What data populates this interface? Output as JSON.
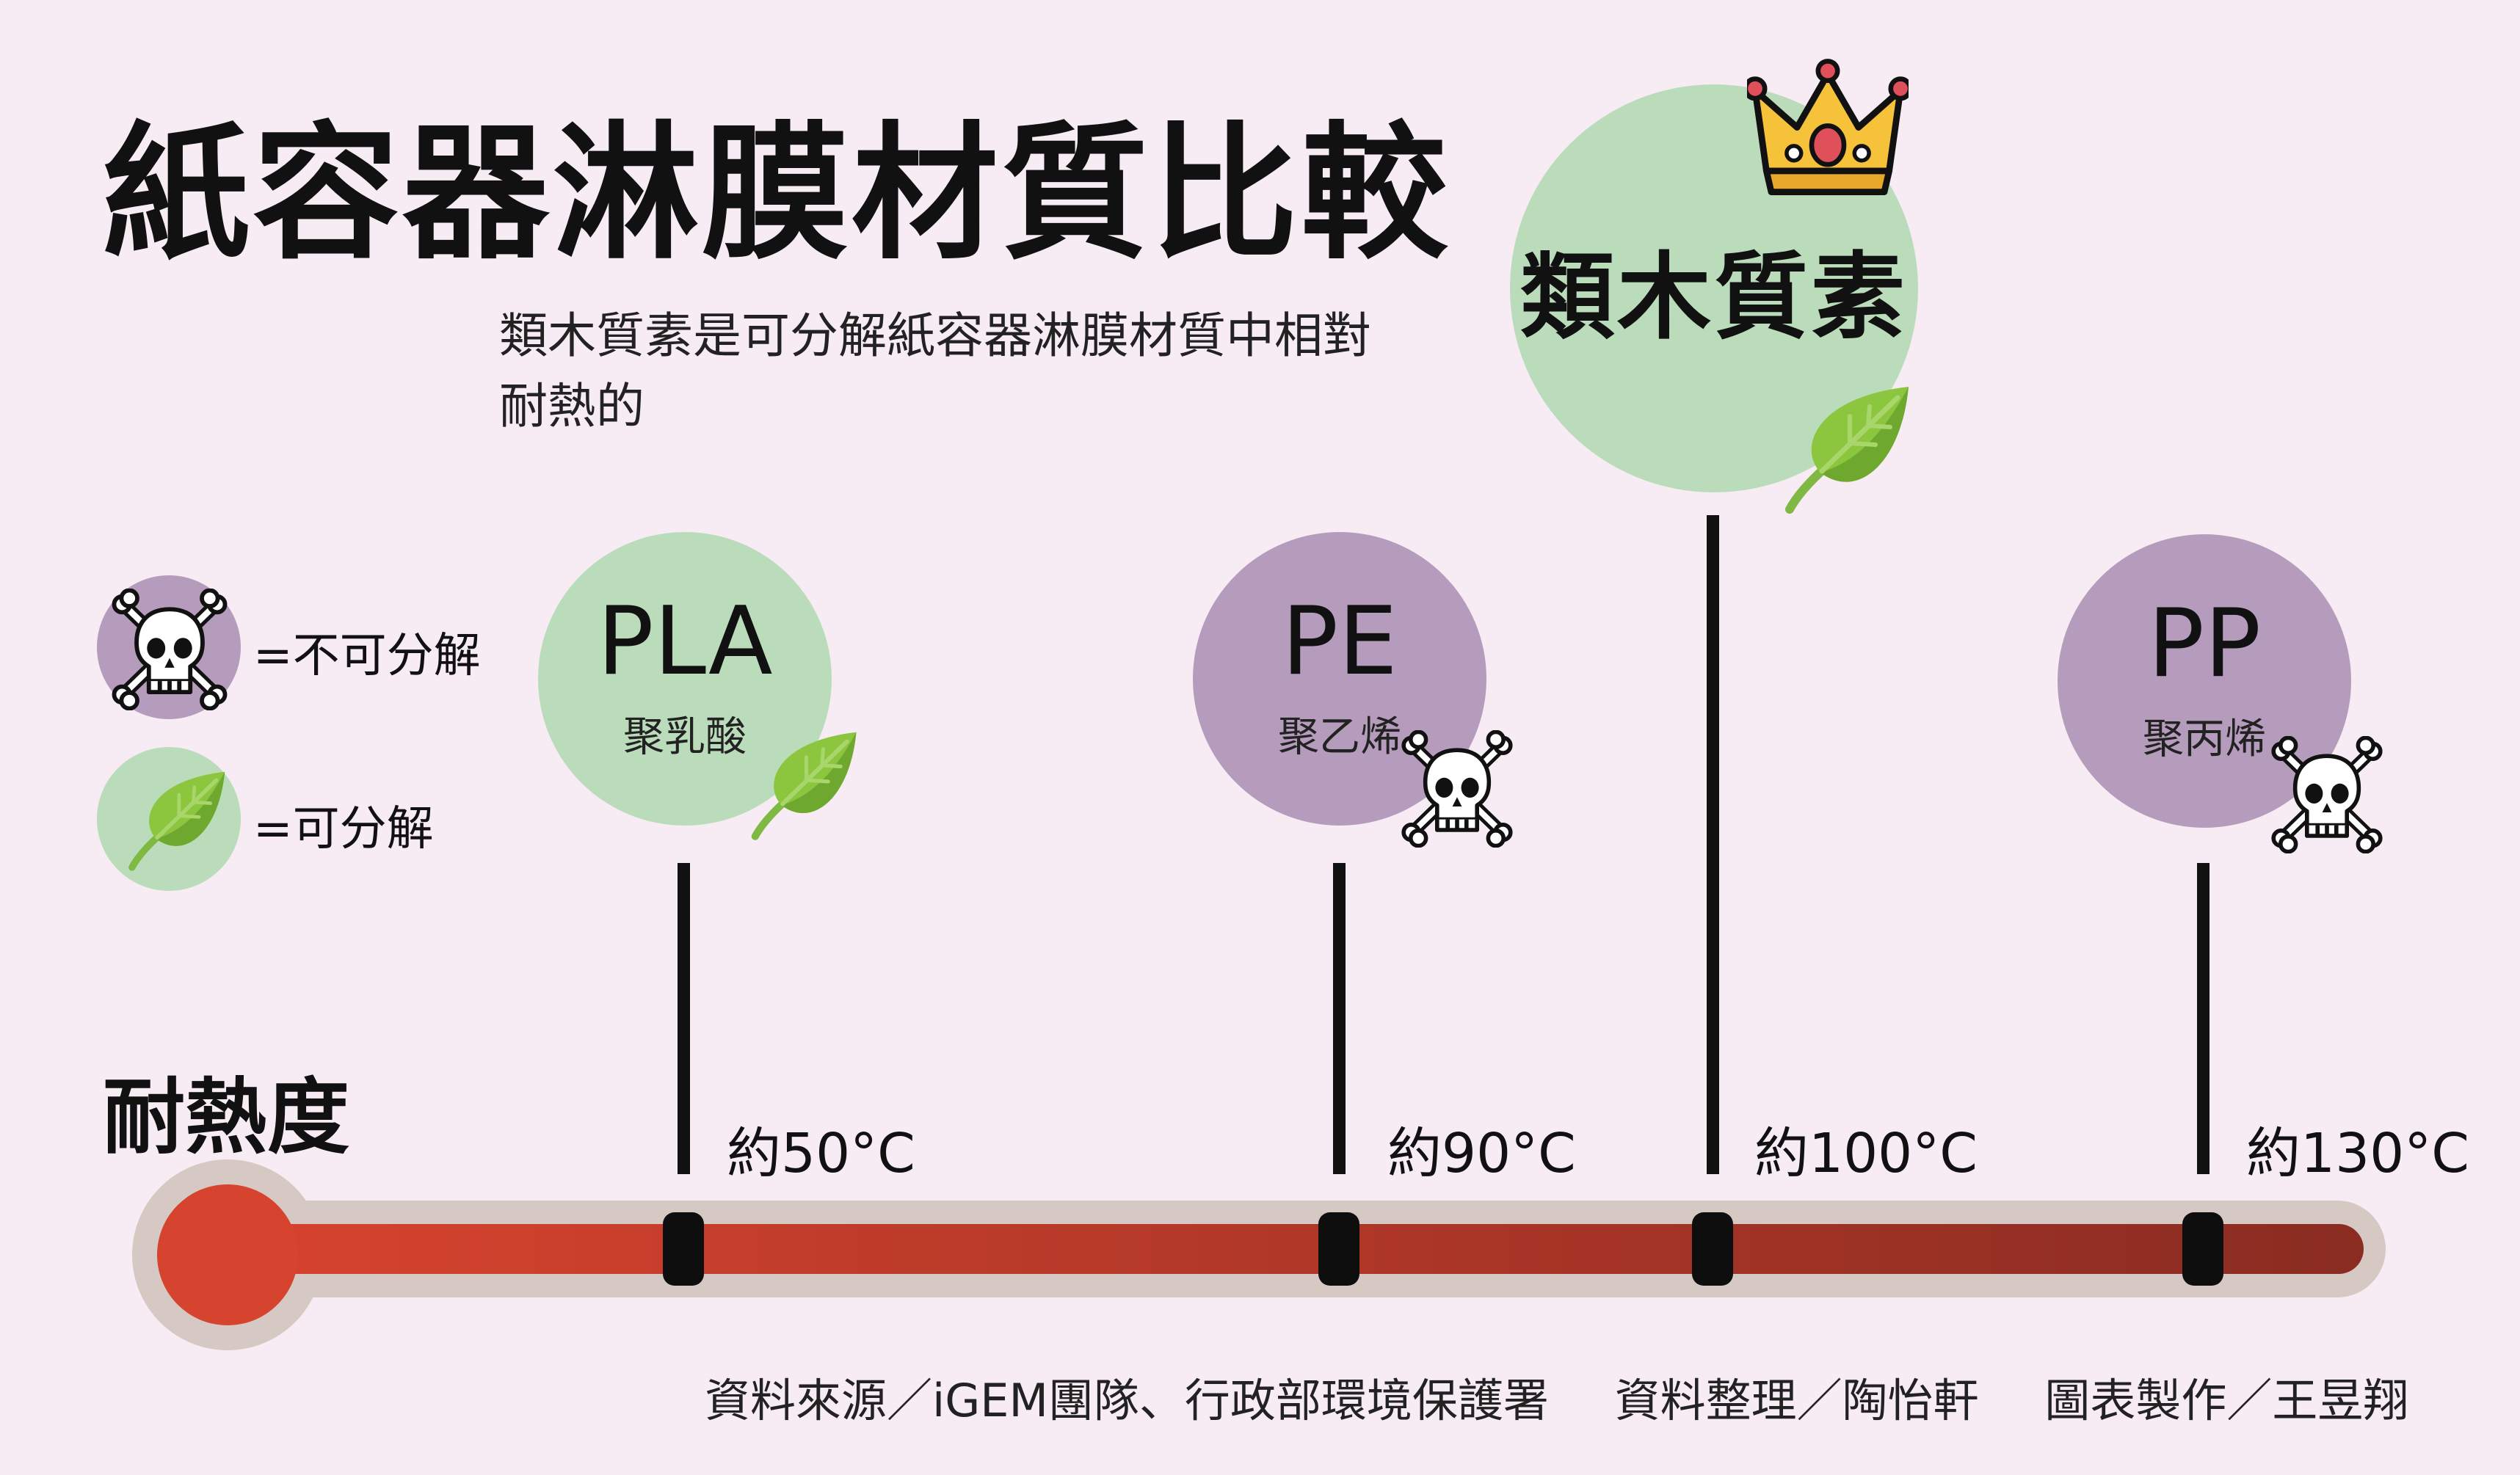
{
  "title": "紙容器淋膜材質比較",
  "subtitle": "類木質素是可分解紙容器淋膜材質中相對耐熱的",
  "axis_label": "耐熱度",
  "legend": {
    "non_degradable": "=不可分解",
    "degradable": "=可分解"
  },
  "materials": [
    {
      "name": "PLA",
      "cn": "聚乳酸",
      "temp": "約50°C",
      "degradable": true
    },
    {
      "name": "PE",
      "cn": "聚乙烯",
      "temp": "約90°C",
      "degradable": false
    },
    {
      "name": "類木質素",
      "cn": "",
      "temp": "約100°C",
      "degradable": true,
      "best": true
    },
    {
      "name": "PP",
      "cn": "聚丙烯",
      "temp": "約130°C",
      "degradable": false
    }
  ],
  "credits": {
    "source": "資料來源／iGEM團隊、行政部環境保護署",
    "compiled": "資料整理／陶怡軒",
    "chart": "圖表製作／王昱翔"
  },
  "colors": {
    "background": "#f7ecf3",
    "green": "#badcbb",
    "purple": "#b59cbc",
    "thermo_start": "#d6432e",
    "thermo_end": "#8a2c22"
  },
  "icons": [
    "skull-crossbones-icon",
    "leaf-icon",
    "crown-icon"
  ]
}
